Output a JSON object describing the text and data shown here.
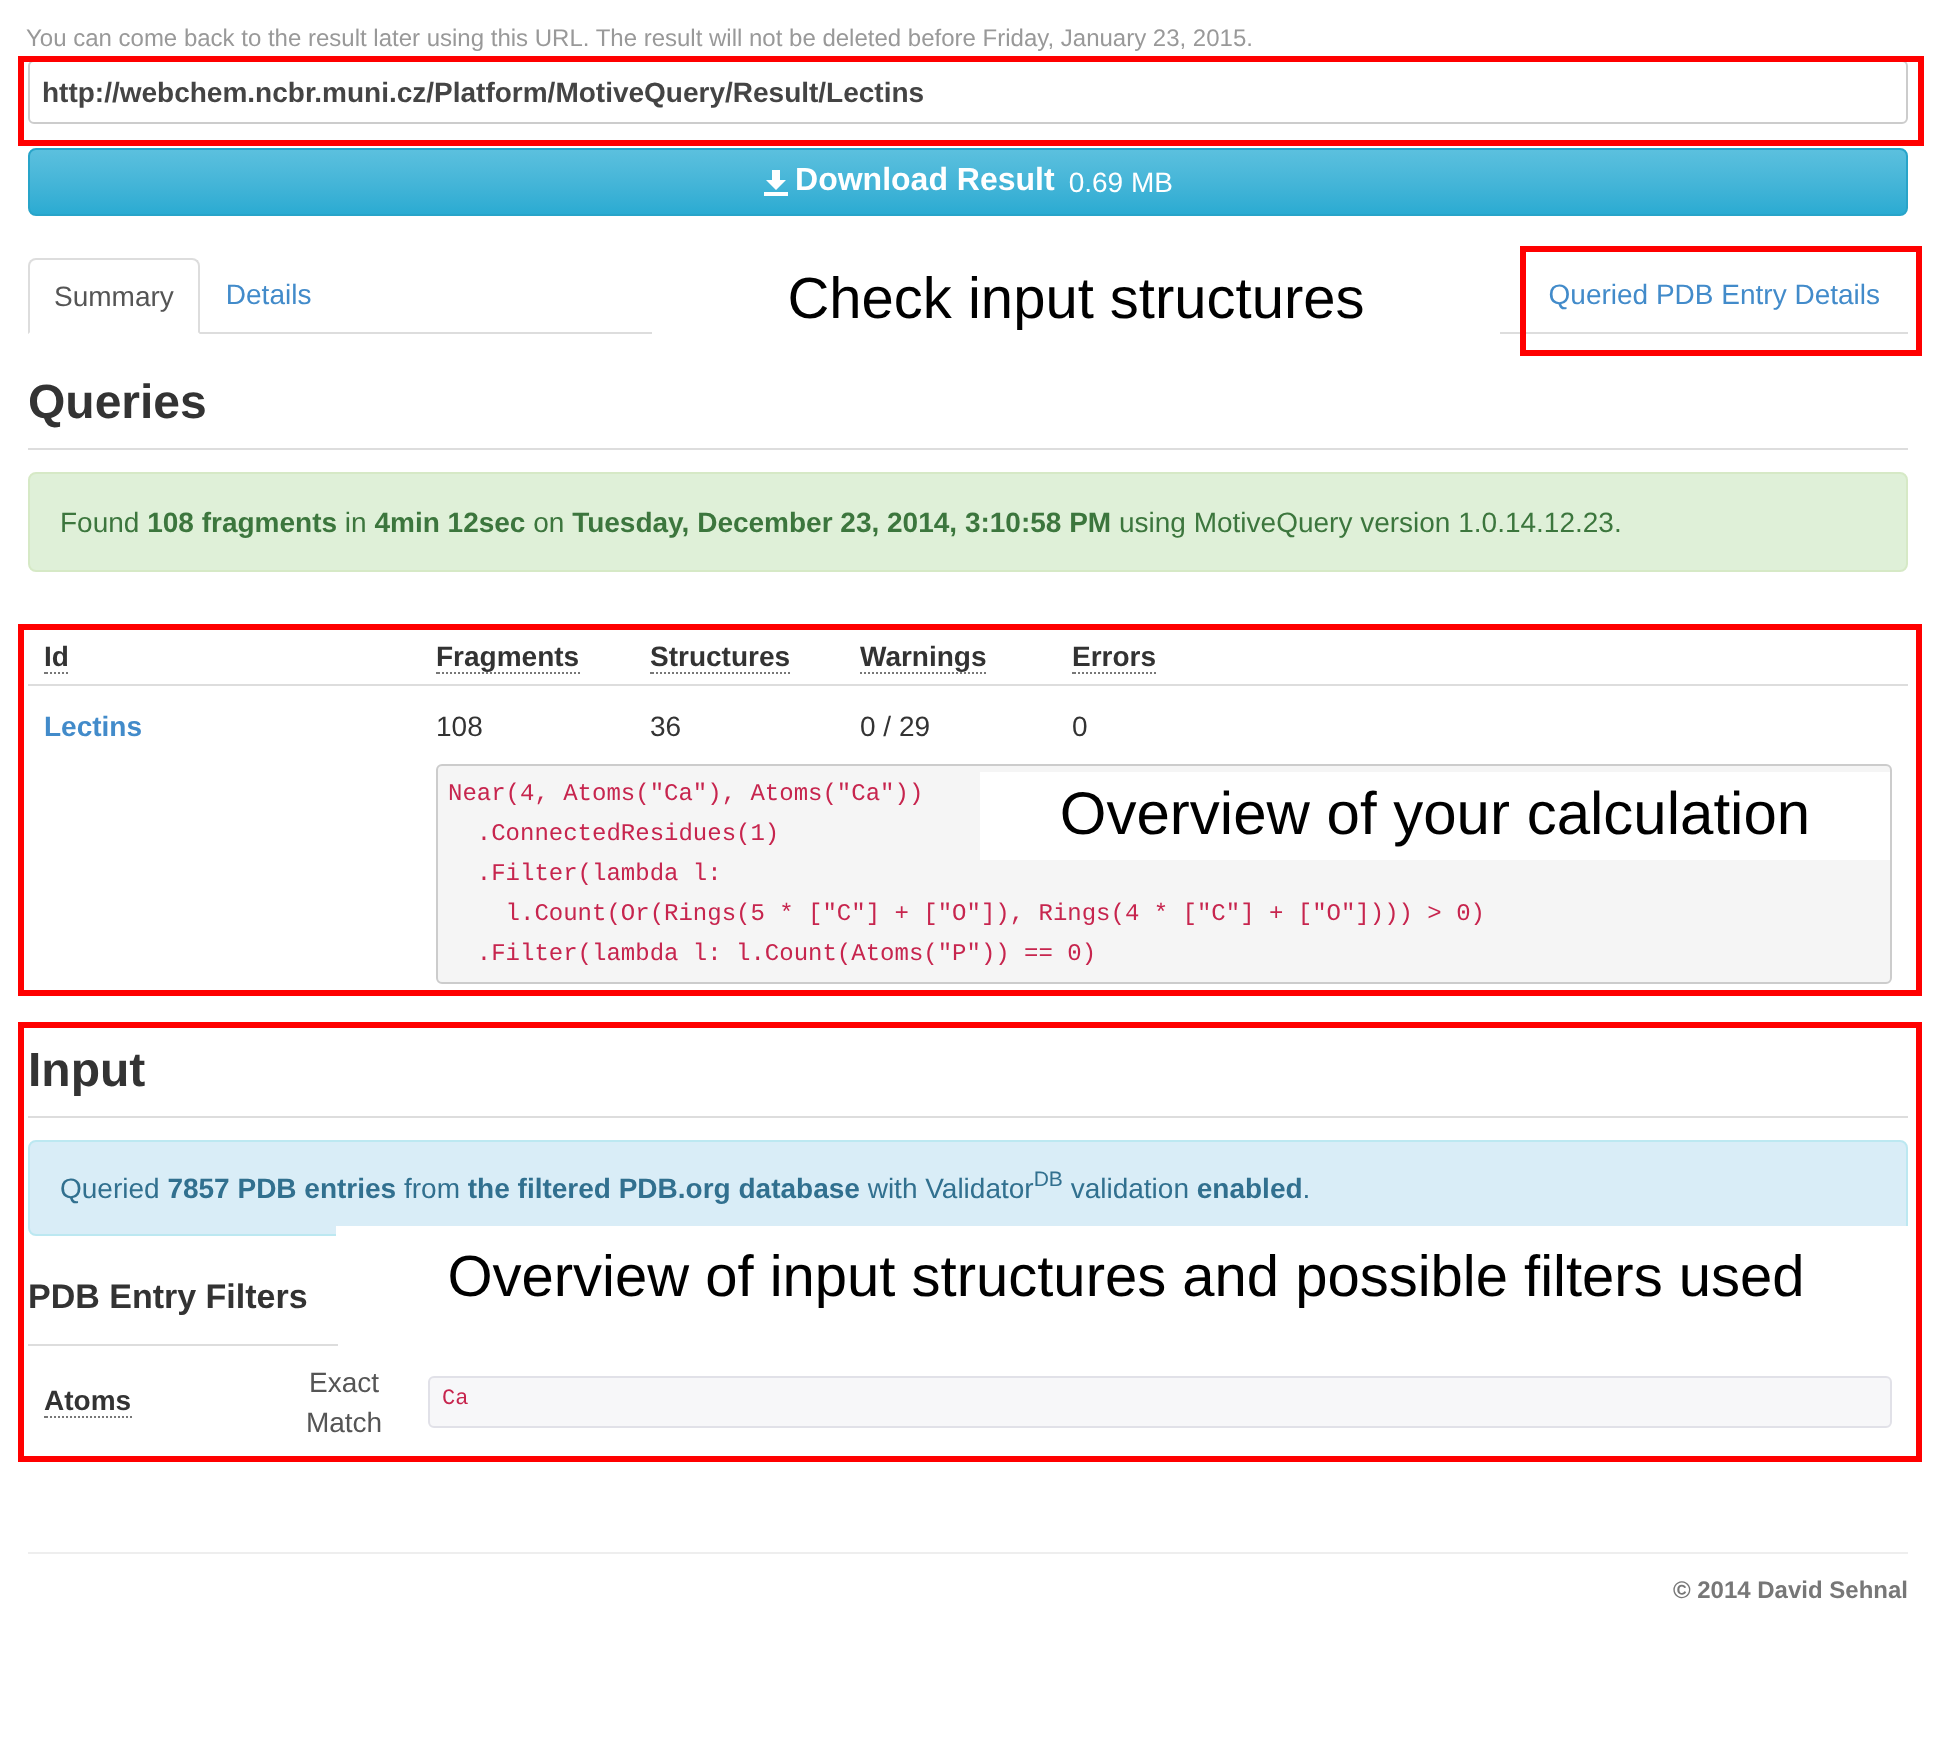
{
  "notice": "You can come back to the result later using this URL. The result will not be deleted before Friday, January 23, 2015.",
  "url_field": {
    "value": "http://webchem.ncbr.muni.cz/Platform/MotiveQuery/Result/Lectins"
  },
  "download_button": {
    "label": "Download Result",
    "size": "0.69 MB"
  },
  "tabs": [
    {
      "label": "Summary",
      "selected": true
    },
    {
      "label": "Details",
      "selected": false
    }
  ],
  "tab_link": "Queried PDB Entry Details",
  "queries": {
    "heading": "Queries",
    "summary": "Found **108 fragments** in **4min 12sec** on **Tuesday, December 23, 2014, 3:10:58 PM** using MotiveQuery version 1.0.14.12.23.",
    "table": {
      "columns": [
        "Id",
        "Fragments",
        "Structures",
        "Warnings",
        "Errors"
      ],
      "rows": [
        {
          "cells": [
            "Lectins",
            "108",
            "36",
            "0 / 29",
            "0"
          ],
          "code": [
            "Near(4, Atoms(\"Ca\"), Atoms(\"Ca\"))",
            "  .ConnectedResidues(1)",
            "  .Filter(lambda l:",
            "    l.Count(Or(Rings(5 * [\"C\"] + [\"O\"]), Rings(4 * [\"C\"] + [\"O\"]))) > 0)",
            "  .Filter(lambda l: l.Count(Atoms(\"P\")) == 0)"
          ]
        }
      ]
    }
  },
  "input": {
    "heading": "Input",
    "summary": "Queried **7857 PDB entries** from **the filtered PDB.org database** with Validator$^{DB}$ validation **enabled**.",
    "filters_heading": "PDB Entry Filters",
    "filters": [
      {
        "name": "Atoms",
        "mode": "Exact Match",
        "value": "Ca"
      }
    ]
  },
  "footer": "© 2014 David Sehnal",
  "annotations": [
    {
      "text": "Check input structures"
    },
    {
      "text": "Overview of your calculation"
    },
    {
      "text": "Overview of input structures and possible filters used"
    }
  ]
}
